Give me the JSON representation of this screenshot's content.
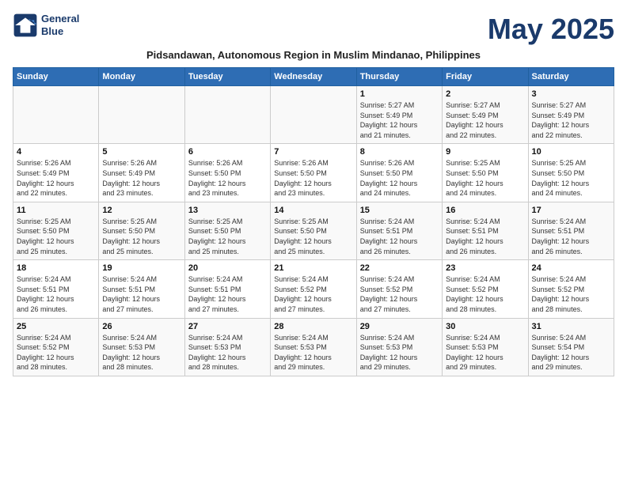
{
  "logo": {
    "line1": "General",
    "line2": "Blue"
  },
  "title": "May 2025",
  "subtitle": "Pidsandawan, Autonomous Region in Muslim Mindanao, Philippines",
  "weekdays": [
    "Sunday",
    "Monday",
    "Tuesday",
    "Wednesday",
    "Thursday",
    "Friday",
    "Saturday"
  ],
  "weeks": [
    [
      {
        "day": "",
        "info": ""
      },
      {
        "day": "",
        "info": ""
      },
      {
        "day": "",
        "info": ""
      },
      {
        "day": "",
        "info": ""
      },
      {
        "day": "1",
        "info": "Sunrise: 5:27 AM\nSunset: 5:49 PM\nDaylight: 12 hours\nand 21 minutes."
      },
      {
        "day": "2",
        "info": "Sunrise: 5:27 AM\nSunset: 5:49 PM\nDaylight: 12 hours\nand 22 minutes."
      },
      {
        "day": "3",
        "info": "Sunrise: 5:27 AM\nSunset: 5:49 PM\nDaylight: 12 hours\nand 22 minutes."
      }
    ],
    [
      {
        "day": "4",
        "info": "Sunrise: 5:26 AM\nSunset: 5:49 PM\nDaylight: 12 hours\nand 22 minutes."
      },
      {
        "day": "5",
        "info": "Sunrise: 5:26 AM\nSunset: 5:49 PM\nDaylight: 12 hours\nand 23 minutes."
      },
      {
        "day": "6",
        "info": "Sunrise: 5:26 AM\nSunset: 5:50 PM\nDaylight: 12 hours\nand 23 minutes."
      },
      {
        "day": "7",
        "info": "Sunrise: 5:26 AM\nSunset: 5:50 PM\nDaylight: 12 hours\nand 23 minutes."
      },
      {
        "day": "8",
        "info": "Sunrise: 5:26 AM\nSunset: 5:50 PM\nDaylight: 12 hours\nand 24 minutes."
      },
      {
        "day": "9",
        "info": "Sunrise: 5:25 AM\nSunset: 5:50 PM\nDaylight: 12 hours\nand 24 minutes."
      },
      {
        "day": "10",
        "info": "Sunrise: 5:25 AM\nSunset: 5:50 PM\nDaylight: 12 hours\nand 24 minutes."
      }
    ],
    [
      {
        "day": "11",
        "info": "Sunrise: 5:25 AM\nSunset: 5:50 PM\nDaylight: 12 hours\nand 25 minutes."
      },
      {
        "day": "12",
        "info": "Sunrise: 5:25 AM\nSunset: 5:50 PM\nDaylight: 12 hours\nand 25 minutes."
      },
      {
        "day": "13",
        "info": "Sunrise: 5:25 AM\nSunset: 5:50 PM\nDaylight: 12 hours\nand 25 minutes."
      },
      {
        "day": "14",
        "info": "Sunrise: 5:25 AM\nSunset: 5:50 PM\nDaylight: 12 hours\nand 25 minutes."
      },
      {
        "day": "15",
        "info": "Sunrise: 5:24 AM\nSunset: 5:51 PM\nDaylight: 12 hours\nand 26 minutes."
      },
      {
        "day": "16",
        "info": "Sunrise: 5:24 AM\nSunset: 5:51 PM\nDaylight: 12 hours\nand 26 minutes."
      },
      {
        "day": "17",
        "info": "Sunrise: 5:24 AM\nSunset: 5:51 PM\nDaylight: 12 hours\nand 26 minutes."
      }
    ],
    [
      {
        "day": "18",
        "info": "Sunrise: 5:24 AM\nSunset: 5:51 PM\nDaylight: 12 hours\nand 26 minutes."
      },
      {
        "day": "19",
        "info": "Sunrise: 5:24 AM\nSunset: 5:51 PM\nDaylight: 12 hours\nand 27 minutes."
      },
      {
        "day": "20",
        "info": "Sunrise: 5:24 AM\nSunset: 5:51 PM\nDaylight: 12 hours\nand 27 minutes."
      },
      {
        "day": "21",
        "info": "Sunrise: 5:24 AM\nSunset: 5:52 PM\nDaylight: 12 hours\nand 27 minutes."
      },
      {
        "day": "22",
        "info": "Sunrise: 5:24 AM\nSunset: 5:52 PM\nDaylight: 12 hours\nand 27 minutes."
      },
      {
        "day": "23",
        "info": "Sunrise: 5:24 AM\nSunset: 5:52 PM\nDaylight: 12 hours\nand 28 minutes."
      },
      {
        "day": "24",
        "info": "Sunrise: 5:24 AM\nSunset: 5:52 PM\nDaylight: 12 hours\nand 28 minutes."
      }
    ],
    [
      {
        "day": "25",
        "info": "Sunrise: 5:24 AM\nSunset: 5:52 PM\nDaylight: 12 hours\nand 28 minutes."
      },
      {
        "day": "26",
        "info": "Sunrise: 5:24 AM\nSunset: 5:53 PM\nDaylight: 12 hours\nand 28 minutes."
      },
      {
        "day": "27",
        "info": "Sunrise: 5:24 AM\nSunset: 5:53 PM\nDaylight: 12 hours\nand 28 minutes."
      },
      {
        "day": "28",
        "info": "Sunrise: 5:24 AM\nSunset: 5:53 PM\nDaylight: 12 hours\nand 29 minutes."
      },
      {
        "day": "29",
        "info": "Sunrise: 5:24 AM\nSunset: 5:53 PM\nDaylight: 12 hours\nand 29 minutes."
      },
      {
        "day": "30",
        "info": "Sunrise: 5:24 AM\nSunset: 5:53 PM\nDaylight: 12 hours\nand 29 minutes."
      },
      {
        "day": "31",
        "info": "Sunrise: 5:24 AM\nSunset: 5:54 PM\nDaylight: 12 hours\nand 29 minutes."
      }
    ]
  ]
}
